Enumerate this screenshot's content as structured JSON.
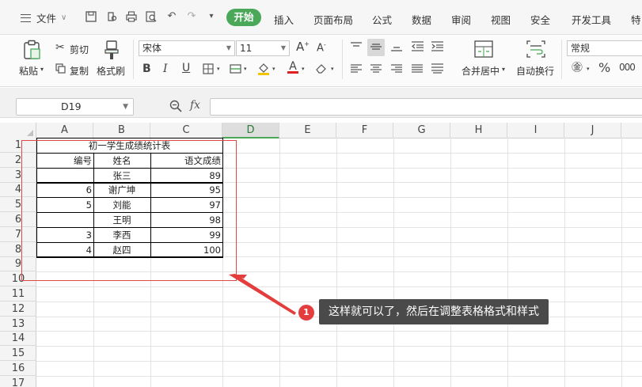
{
  "menubar": {
    "file_label": "文件",
    "tabs": [
      "开始",
      "插入",
      "页面布局",
      "公式",
      "数据",
      "审阅",
      "视图",
      "安全",
      "开发工具",
      "特"
    ]
  },
  "ribbon": {
    "paste": "粘贴",
    "cut": "剪切",
    "copy": "复制",
    "format_painter": "格式刷",
    "font_name": "宋体",
    "font_size": "11",
    "merge_center": "合并居中",
    "wrap_text": "自动换行",
    "number_format": "常规"
  },
  "formula_bar": {
    "name_box": "D19",
    "fx": "fx"
  },
  "sheet": {
    "columns": [
      "A",
      "B",
      "C",
      "D",
      "E",
      "F",
      "G",
      "H",
      "I",
      "J"
    ],
    "rows": [
      "1",
      "2",
      "3",
      "4",
      "5",
      "6",
      "7",
      "8",
      "9",
      "10",
      "11",
      "12",
      "13",
      "14",
      "15",
      "16",
      "17"
    ],
    "active_column": "D",
    "table_title": "初一学生成绩统计表",
    "headers": [
      "编号",
      "姓名",
      "语文成绩"
    ],
    "data_rows": [
      [
        "",
        "张三",
        "89"
      ],
      [
        "6",
        "谢广坤",
        "95"
      ],
      [
        "5",
        "刘能",
        "97"
      ],
      [
        "",
        "王明",
        "98"
      ],
      [
        "3",
        "李西",
        "99"
      ],
      [
        "4",
        "赵四",
        "100"
      ]
    ]
  },
  "annotation": {
    "step_number": "1",
    "text": "这样就可以了，然后在调整表格格式和样式"
  },
  "colors": {
    "accent_green": "#4aa858",
    "annotation_red": "#e33d3d",
    "callout_bg": "#4a4a4a"
  }
}
